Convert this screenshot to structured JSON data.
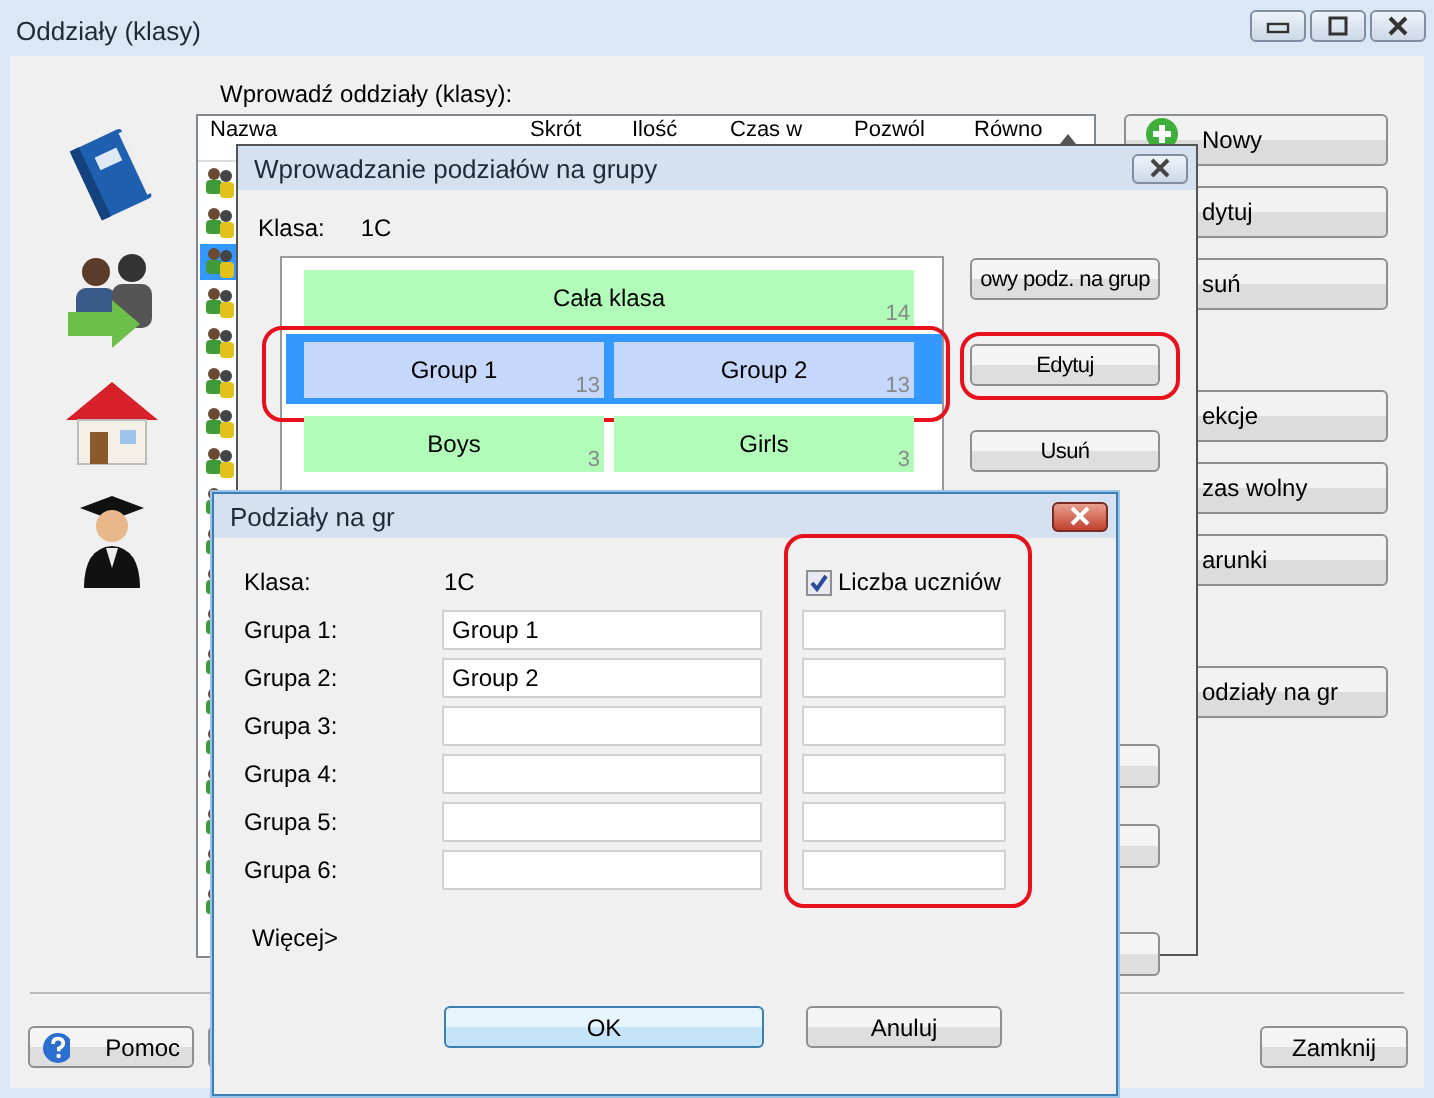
{
  "main_window": {
    "title": "Oddziały (klasy)",
    "list_label": "Wprowadź oddziały (klasy):",
    "table": {
      "columns": [
        "Nazwa",
        "Skrót",
        "Ilość",
        "Czas w",
        "Pozwól",
        "Równo"
      ],
      "rows": [
        {
          "selected": false
        },
        {
          "selected": false
        },
        {
          "selected": true
        },
        {
          "selected": false
        },
        {
          "selected": false
        },
        {
          "selected": false
        },
        {
          "selected": false
        },
        {
          "selected": false
        },
        {
          "selected": false
        },
        {
          "selected": false
        },
        {
          "selected": false
        },
        {
          "selected": false
        },
        {
          "selected": false
        },
        {
          "selected": false
        },
        {
          "selected": false
        },
        {
          "selected": false
        },
        {
          "selected": false
        },
        {
          "selected": false
        },
        {
          "selected": false
        }
      ]
    },
    "side_buttons": [
      [
        {
          "label": "Nowy",
          "kind": "add"
        },
        {
          "label": "dytuj",
          "kind": "plain"
        },
        {
          "label": "suń",
          "kind": "plain"
        }
      ],
      [
        {
          "label": "ekcje",
          "kind": "plain"
        },
        {
          "label": "zas wolny",
          "kind": "plain"
        },
        {
          "label": "arunki",
          "kind": "plain"
        }
      ],
      [
        {
          "label": "odziały na gr",
          "kind": "plain"
        }
      ]
    ],
    "footer_buttons": [
      {
        "label": "Pomoc",
        "kind": "help"
      },
      {
        "label": "Zamknij",
        "kind": "plain"
      }
    ]
  },
  "divisions_dialog": {
    "title": "Wprowadzanie podziałów na grupy",
    "class_label": "Klasa:",
    "class_value": "1C",
    "divisions": [
      {
        "selected": false,
        "highlighted": false,
        "groups": [
          {
            "name": "Cała klasa",
            "count": "14"
          }
        ]
      },
      {
        "selected": true,
        "highlighted": true,
        "groups": [
          {
            "name": "Group 1",
            "count": "13"
          },
          {
            "name": "Group 2",
            "count": "13"
          }
        ]
      },
      {
        "selected": false,
        "highlighted": false,
        "groups": [
          {
            "name": "Boys",
            "count": "3"
          },
          {
            "name": "Girls",
            "count": "3"
          }
        ]
      }
    ],
    "buttons": [
      {
        "label": "owy podz. na grup",
        "highlighted": false
      },
      {
        "label": "Edytuj",
        "highlighted": true
      },
      {
        "label": "Usuń",
        "highlighted": false
      }
    ]
  },
  "edit_dialog": {
    "title": "Podziały na gr",
    "class_label": "Klasa:",
    "class_value": "1C",
    "count_checkbox": {
      "label": "Liczba uczniów",
      "checked": true,
      "highlighted": true
    },
    "groups": [
      {
        "label": "Grupa 1:",
        "value": "Group 1"
      },
      {
        "label": "Grupa 2:",
        "value": "Group 2"
      },
      {
        "label": "Grupa 3:"
      },
      {
        "label": "Grupa 4:"
      },
      {
        "label": "Grupa 5:"
      },
      {
        "label": "Grupa 6:"
      }
    ],
    "more_link": "Więcej>",
    "buttons": [
      {
        "label": "OK",
        "default": true
      },
      {
        "label": "Anuluj",
        "default": false
      }
    ]
  }
}
